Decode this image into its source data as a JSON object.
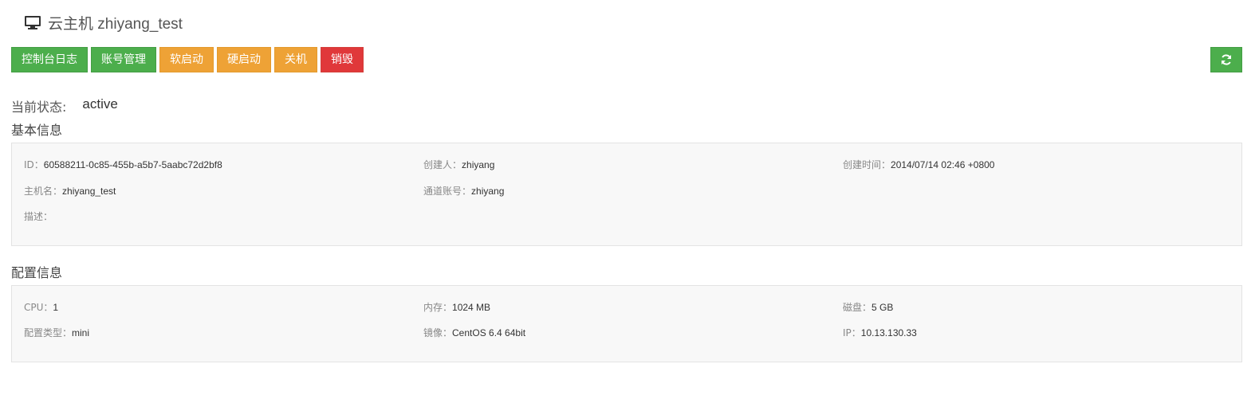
{
  "header": {
    "icon": "monitor-icon",
    "title": "云主机 zhiyang_test"
  },
  "toolbar": {
    "buttons": [
      {
        "label": "控制台日志",
        "color": "#4cae4c"
      },
      {
        "label": "账号管理",
        "color": "#4cae4c"
      },
      {
        "label": "软启动",
        "color": "#eea236"
      },
      {
        "label": "硬启动",
        "color": "#eea236"
      },
      {
        "label": "关机",
        "color": "#eea236"
      },
      {
        "label": "销毁",
        "color": "#e0383a"
      }
    ],
    "refresh_icon": "refresh-icon"
  },
  "status": {
    "label": "当前状态:",
    "value": "active"
  },
  "basic": {
    "title": "基本信息",
    "id_label": "ID：",
    "id_value": "60588211-0c85-455b-a5b7-5aabc72d2bf8",
    "creator_label": "创建人：",
    "creator_value": "zhiyang",
    "created_label": "创建时间：",
    "created_value": "2014/07/14 02:46 +0800",
    "hostname_label": "主机名：",
    "hostname_value": "zhiyang_test",
    "channel_label": "通道账号：",
    "channel_value": "zhiyang",
    "desc_label": "描述：",
    "desc_value": ""
  },
  "config": {
    "title": "配置信息",
    "cpu_label": "CPU：",
    "cpu_value": "1",
    "mem_label": "内存：",
    "mem_value": "1024 MB",
    "disk_label": "磁盘：",
    "disk_value": "5 GB",
    "type_label": "配置类型：",
    "type_value": "mini",
    "image_label": "镜像：",
    "image_value": "CentOS 6.4 64bit",
    "ip_label": "IP：",
    "ip_value": "10.13.130.33"
  }
}
